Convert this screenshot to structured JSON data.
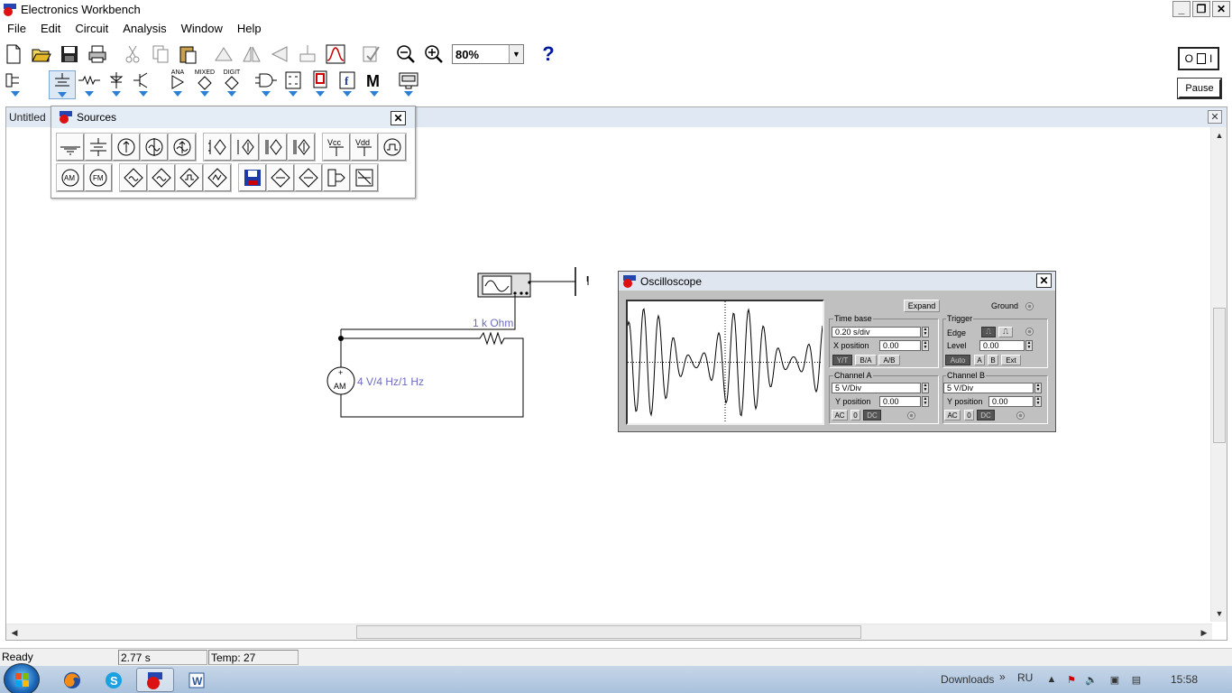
{
  "window": {
    "title": "Electronics Workbench"
  },
  "menu": [
    "File",
    "Edit",
    "Circuit",
    "Analysis",
    "Window",
    "Help"
  ],
  "toolbar": {
    "zoom": "80%",
    "help": "?"
  },
  "parts_bin_labels": {
    "analog": "ANA",
    "mixed": "MIXED",
    "digital": "DIGIT",
    "misc": "M"
  },
  "power": {
    "off": "O",
    "on": "I"
  },
  "pause_label": "Pause",
  "document": {
    "title": "Untitled"
  },
  "sources_panel": {
    "title": "Sources",
    "vcc": "Vcc",
    "vdd": "Vdd",
    "am": "AM",
    "fm": "FM"
  },
  "circuit": {
    "resistor_label": "1 k Ohm",
    "source_label": "4 V/4 Hz/1 Hz",
    "source_symbol": "AM",
    "plus": "+",
    "ground_tick": "I"
  },
  "oscilloscope": {
    "title": "Oscilloscope",
    "expand_label": "Expand",
    "ground_label": "Ground",
    "time_base": {
      "title": "Time base",
      "value": "0.20 s/div",
      "xpos_label": "X position",
      "xpos_value": "0.00",
      "modes": [
        "Y/T",
        "B/A",
        "A/B"
      ]
    },
    "trigger": {
      "title": "Trigger",
      "edge_label": "Edge",
      "level_label": "Level",
      "level_value": "0.00",
      "auto_label": "Auto",
      "sources": [
        "A",
        "B",
        "Ext"
      ]
    },
    "channel_a": {
      "title": "Channel A",
      "value": "5 V/Div",
      "ypos_label": "Y position",
      "ypos_value": "0.00",
      "coupling": [
        "AC",
        "0",
        "DC"
      ]
    },
    "channel_b": {
      "title": "Channel B",
      "value": "5 V/Div",
      "ypos_label": "Y position",
      "ypos_value": "0.00",
      "coupling": [
        "AC",
        "0",
        "DC"
      ]
    }
  },
  "status": {
    "state": "Ready",
    "time": "2.77 s",
    "temp": "Temp:  27"
  },
  "taskbar": {
    "downloads": "Downloads",
    "chevron": "»",
    "lang": "RU",
    "clock": "15:58"
  }
}
